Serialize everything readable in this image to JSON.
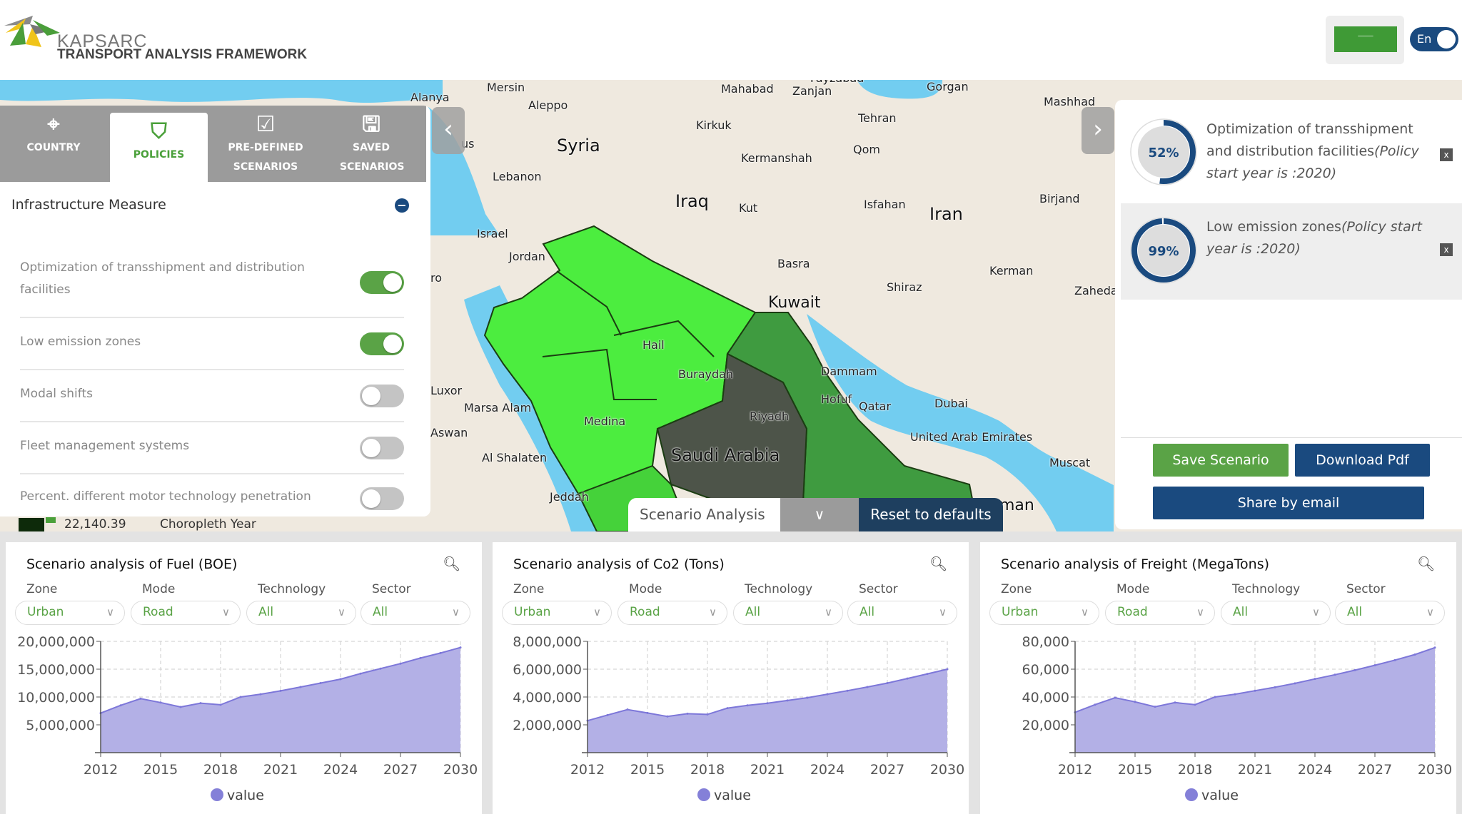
{
  "header": {
    "brand": "KAPSARC",
    "subtitle": "TRANSPORT ANALYSIS FRAMEWORK",
    "flag_icon": "saudi-flag-icon",
    "lang_toggle": "En"
  },
  "tabs": [
    {
      "label": "COUNTRY",
      "icon": "map-pin-icon"
    },
    {
      "label": "POLICIES",
      "icon": "shield-check-icon",
      "active": true
    },
    {
      "label": "PRE-DEFINED SCENARIOS",
      "icon": "checklist-icon"
    },
    {
      "label": "SAVED SCENARIOS",
      "icon": "floppy-disk-icon"
    }
  ],
  "policies": {
    "section": "Infrastructure Measure",
    "items": [
      {
        "label": "Optimization of transshipment and distribution facilities",
        "on": true
      },
      {
        "label": "Low emission zones",
        "on": true
      },
      {
        "label": "Modal shifts",
        "on": false
      },
      {
        "label": "Fleet management systems",
        "on": false
      },
      {
        "label": "Percent. different motor technology penetration",
        "on": false
      }
    ]
  },
  "map": {
    "legend_value": "22,140.39",
    "legend_title": "Choropleth Year",
    "labels": [
      "Alanya",
      "Mersin",
      "Aleppo",
      "Syria",
      "Lebanon",
      "Israel",
      "Jordan",
      "Iraq",
      "Mahabad",
      "Zanjan",
      "Kirkuk",
      "Tehran",
      "Qom",
      "Kermanshah",
      "Kut",
      "Isfahan",
      "Iran",
      "Birjand",
      "Gorgan",
      "Mashhad",
      "Basra",
      "Kuwait",
      "Shiraz",
      "Kerman",
      "Zahedan",
      "Hail",
      "Buraydah",
      "Dammam",
      "Hofuf",
      "Qatar",
      "Dubai",
      "Riyadh",
      "United Arab Emirates",
      "Muscat",
      "Saudi Arabia",
      "Medina",
      "Marsa Alam",
      "Luxor",
      "Aswan",
      "Al Shalaten",
      "Jeddah",
      "man",
      "us",
      "ro",
      "Fayzabad"
    ],
    "colors": {
      "light": "#4ced3f",
      "medium": "#3f9b40",
      "dark": "#4d5449",
      "water": "#72cdf0",
      "land": "#efe9df"
    }
  },
  "selected_policies": [
    {
      "percent": 52,
      "name": "Optimization of transshipment and distribution facilities",
      "note": "(Policy start year is :2020)"
    },
    {
      "percent": 99,
      "name": "Low emission zones",
      "note": "(Policy start year is :2020)"
    }
  ],
  "actions": {
    "save": "Save Scenario",
    "download": "Download Pdf",
    "share": "Share by email"
  },
  "scenario_bar": {
    "label": "Scenario Analysis",
    "reset": "Reset to defaults"
  },
  "filters": {
    "labels": [
      "Zone",
      "Mode",
      "Technology",
      "Sector"
    ],
    "values": [
      "Urban",
      "Road",
      "All",
      "All"
    ]
  },
  "colors": {
    "accent_green": "#5aa346",
    "navy": "#1a4a7f",
    "area": "#b3b0e6",
    "line": "#7d77d9"
  },
  "chart_data": [
    {
      "type": "area",
      "title": "Scenario analysis of Fuel (BOE)",
      "x": [
        2012,
        2013,
        2014,
        2015,
        2016,
        2017,
        2018,
        2019,
        2020,
        2021,
        2022,
        2023,
        2024,
        2025,
        2026,
        2027,
        2028,
        2029,
        2030
      ],
      "series": [
        {
          "name": "value",
          "values": [
            7100000,
            8500000,
            9700000,
            9000000,
            8200000,
            8900000,
            8600000,
            10000000,
            10500000,
            11100000,
            11800000,
            12500000,
            13200000,
            14200000,
            15100000,
            16000000,
            17000000,
            17900000,
            18900000
          ]
        }
      ],
      "xticks": [
        "2012",
        "2015",
        "2018",
        "2021",
        "2024",
        "2027",
        "2030"
      ],
      "yticks": [
        "5,000,000",
        "10,000,000",
        "15,000,000",
        "20,000,000"
      ],
      "ylim": [
        0,
        20000000
      ],
      "grid": true,
      "legend": "bottom"
    },
    {
      "type": "area",
      "title": "Scenario analysis of Co2 (Tons)",
      "x": [
        2012,
        2013,
        2014,
        2015,
        2016,
        2017,
        2018,
        2019,
        2020,
        2021,
        2022,
        2023,
        2024,
        2025,
        2026,
        2027,
        2028,
        2029,
        2030
      ],
      "series": [
        {
          "name": "value",
          "values": [
            2300000,
            2700000,
            3100000,
            2850000,
            2600000,
            2800000,
            2750000,
            3200000,
            3400000,
            3550000,
            3750000,
            3950000,
            4200000,
            4450000,
            4720000,
            5000000,
            5330000,
            5660000,
            6000000
          ]
        }
      ],
      "xticks": [
        "2012",
        "2015",
        "2018",
        "2021",
        "2024",
        "2027",
        "2030"
      ],
      "yticks": [
        "2,000,000",
        "4,000,000",
        "6,000,000",
        "8,000,000"
      ],
      "ylim": [
        0,
        8000000
      ],
      "grid": true,
      "legend": "bottom"
    },
    {
      "type": "area",
      "title": "Scenario analysis of Freight (MegaTons)",
      "x": [
        2012,
        2013,
        2014,
        2015,
        2016,
        2017,
        2018,
        2019,
        2020,
        2021,
        2022,
        2023,
        2024,
        2025,
        2026,
        2027,
        2028,
        2029,
        2030
      ],
      "series": [
        {
          "name": "value",
          "values": [
            29000,
            34500,
            39500,
            36500,
            33000,
            36000,
            34500,
            40000,
            42000,
            44500,
            47000,
            49800,
            53000,
            56000,
            59300,
            62800,
            66500,
            70500,
            75500
          ]
        }
      ],
      "xticks": [
        "2012",
        "2015",
        "2018",
        "2021",
        "2024",
        "2027",
        "2030"
      ],
      "yticks": [
        "20,000",
        "40,000",
        "60,000",
        "80,000"
      ],
      "ylim": [
        0,
        80000
      ],
      "grid": true,
      "legend": "bottom"
    }
  ]
}
